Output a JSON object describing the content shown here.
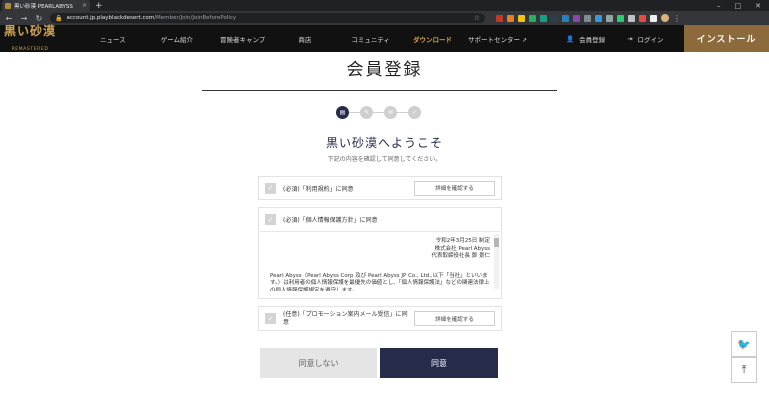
{
  "browser": {
    "tab_title": "黒い砂漠 PEARLABYSS",
    "tab_close": "×",
    "new_tab": "+",
    "url_host": "account.jp.playblackdesert.com",
    "url_path": "/Member/Join/JoinBeforePolicy",
    "window_controls": [
      "–",
      "□",
      "✕"
    ]
  },
  "site": {
    "logo_main": "黒い砂漠",
    "logo_sub": "REMASTERED",
    "nav": [
      "ニュース",
      "ゲーム紹介",
      "冒険者キャンプ",
      "商店",
      "コミュニティ",
      "ダウンロード",
      "サポートセンター"
    ],
    "signup": "会員登録",
    "login": "ログイン",
    "install": "インストール"
  },
  "page": {
    "title": "会員登録",
    "welcome": "黒い砂漠へようこそ",
    "subtitle": "下記の内容を確認して同意してください。",
    "terms_label": "(必須)「利用規約」に同意",
    "privacy_label": "(必須)「個人情報保護方針」に同意",
    "promo_label_1": "(任意)「プロモーション案内メール受信」に同",
    "promo_label_2": "意",
    "detail_button": "詳細を確認する",
    "privacy_date": "令和2年3月25日 制定",
    "privacy_company": "株式会社 Pearl Abyss",
    "privacy_ceo": "代表取締役社長 鄭 景仁",
    "privacy_body": "Pearl Abyss（Pearl Abyss Corp 及び Pearl Abyss JP Co., Ltd.,以下「当社」といいます。）は利用者の個人情報保護を最優先の価値とし、「個人情報保護法」などの関連法律上の個人情報保護規定を遵守します。",
    "disagree_button": "同意しない",
    "agree_button": "同意"
  },
  "colors": {
    "accent": "#262b4c",
    "gold": "#d1a552",
    "install": "#8c6a3b"
  }
}
